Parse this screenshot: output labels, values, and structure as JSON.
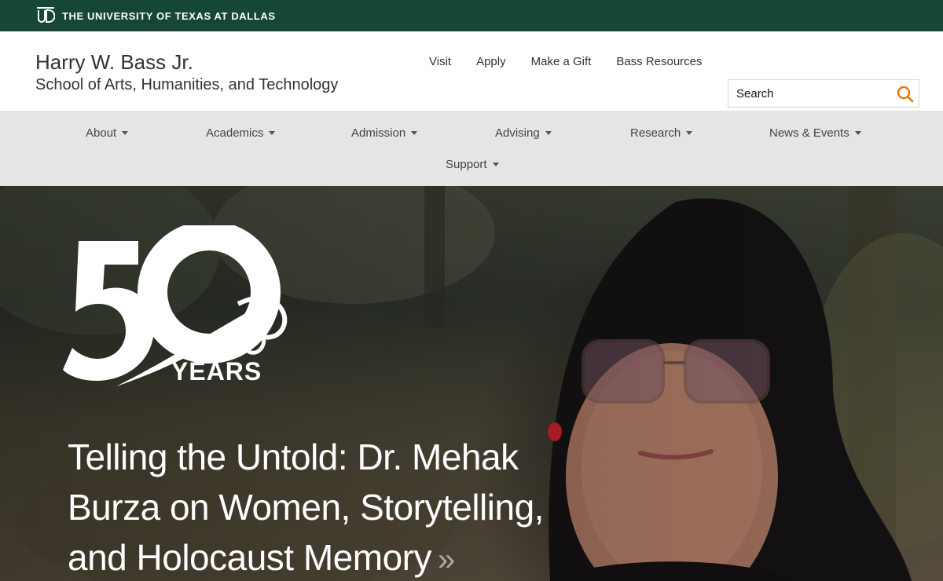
{
  "top_bar": {
    "university_name": "THE UNIVERSITY OF TEXAS AT DALLAS",
    "logo_icon": "utd-monogram-icon"
  },
  "header": {
    "school_line1": "Harry W. Bass Jr.",
    "school_line2": "School of Arts, Humanities, and Technology",
    "utility_links": [
      "Visit",
      "Apply",
      "Make a Gift",
      "Bass Resources"
    ],
    "search": {
      "placeholder": "Search",
      "icon": "search-icon",
      "icon_color": "#e87500"
    }
  },
  "main_nav": {
    "items": [
      "About",
      "Academics",
      "Admission",
      "Advising",
      "Research",
      "News & Events",
      "Support"
    ]
  },
  "hero": {
    "badge_number": "50",
    "badge_text": "YEARS",
    "headline": "Telling the Untold: Dr. Mehak Burza on Women, Storytelling, and Holocaust Memory",
    "headline_arrow": "»"
  },
  "colors": {
    "utd_green": "#154734",
    "nav_bg": "#e5e5e5",
    "accent_orange": "#e87500"
  }
}
